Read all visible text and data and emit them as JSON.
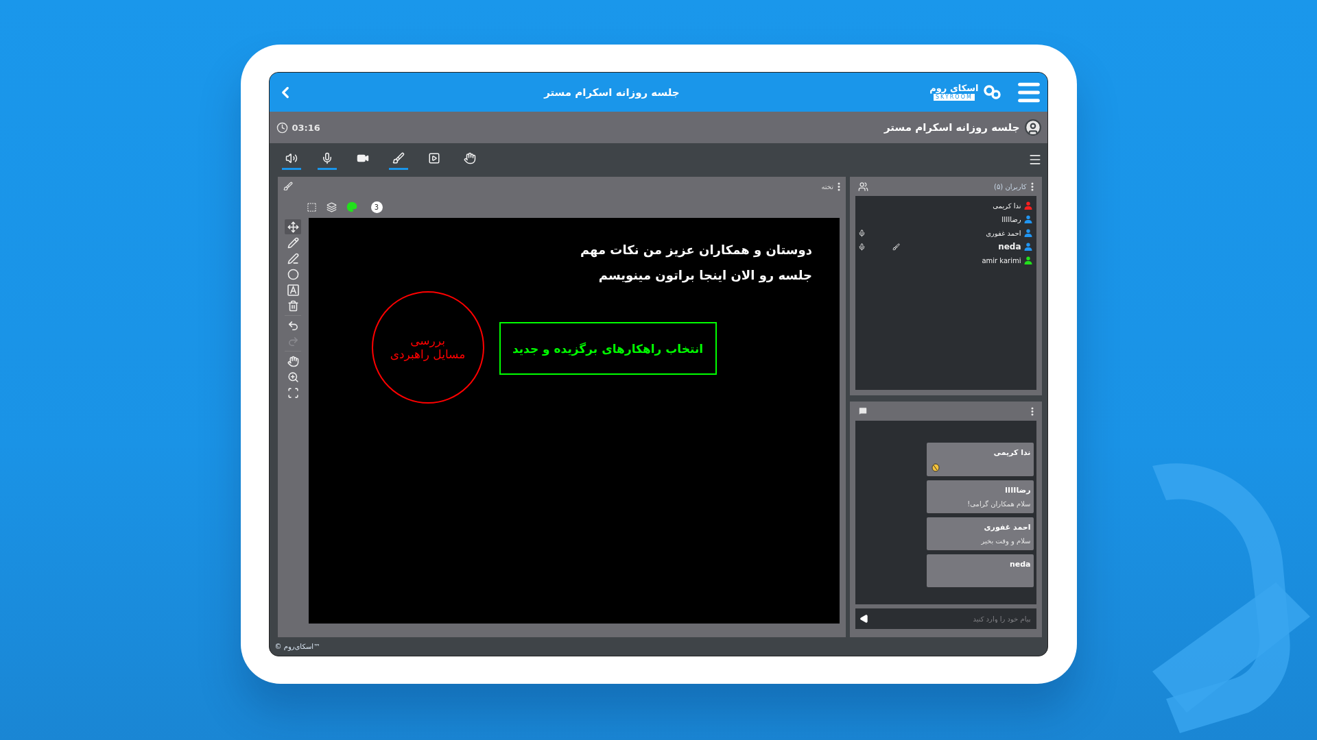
{
  "header": {
    "title": "جلسه روزانه اسکرام مستر",
    "logo_text": "اسکای روم",
    "logo_subtext": "SKYROOM"
  },
  "session_bar": {
    "title": "جلسه روزانه اسکرام مستر",
    "timer": "03:16"
  },
  "toolbar": {
    "items": [
      {
        "kind": "speaker",
        "active": true
      },
      {
        "kind": "mic",
        "active": true
      },
      {
        "kind": "camera",
        "active": false
      },
      {
        "kind": "brush",
        "active": true
      },
      {
        "kind": "screen",
        "active": false
      },
      {
        "kind": "hand",
        "active": false
      }
    ]
  },
  "whiteboard": {
    "title": "تخته",
    "page": "3",
    "top_tools": [
      {
        "kind": "select"
      },
      {
        "kind": "layers"
      },
      {
        "kind": "palette",
        "color": "#22e01c"
      }
    ],
    "tools": [
      {
        "kind": "move",
        "selected": true,
        "disabled": false
      },
      {
        "kind": "pencil",
        "selected": false,
        "disabled": false
      },
      {
        "kind": "pen",
        "selected": false,
        "disabled": false
      },
      {
        "kind": "circle",
        "selected": false,
        "disabled": false
      },
      {
        "kind": "text",
        "selected": false,
        "disabled": false
      },
      {
        "kind": "trash",
        "selected": false,
        "disabled": false
      },
      {
        "kind": "undo",
        "selected": false,
        "disabled": false
      },
      {
        "kind": "redo",
        "selected": false,
        "disabled": true
      },
      {
        "kind": "hand",
        "selected": false,
        "disabled": false
      },
      {
        "kind": "zoom",
        "selected": false,
        "disabled": false
      },
      {
        "kind": "fit",
        "selected": false,
        "disabled": false
      }
    ],
    "shapes": [
      {
        "kind": "text",
        "color": "#ffffff",
        "lines": [
          "دوستان و همکاران عزیز من نکات مهم",
          "جلسه رو الان اینجا براتون مینویسم"
        ]
      },
      {
        "kind": "box",
        "color": "#00ff00",
        "lines": [
          "انتخاب راهکارهای برگزیده و جدید"
        ]
      },
      {
        "kind": "circle",
        "color": "#ff0000",
        "lines": [
          "بررسی",
          "مسایل راهبردی"
        ]
      }
    ]
  },
  "users": {
    "title": "کاربران",
    "count": "(۵)",
    "items": [
      {
        "name": "ندا کریمی",
        "color": "#ff1f1f",
        "mic": false,
        "drawing": false,
        "current": false
      },
      {
        "name": "رضاIIII",
        "color": "#2196f3",
        "mic": false,
        "drawing": false,
        "current": false
      },
      {
        "name": "احمد غفوری",
        "color": "#2196f3",
        "mic": true,
        "drawing": false,
        "current": false
      },
      {
        "name": "neda",
        "color": "#2196f3",
        "mic": true,
        "drawing": true,
        "current": true
      },
      {
        "name": "amir karimi",
        "color": "#22e01c",
        "mic": false,
        "drawing": false,
        "current": false
      }
    ]
  },
  "chat": {
    "placeholder": "پیام خود را وارد کنید",
    "messages": [
      {
        "kind": "emoji",
        "sender": "ندا کریمی"
      },
      {
        "kind": "text",
        "sender": "رضاIIII",
        "text": "سلام همکاران گرامی!"
      },
      {
        "kind": "text",
        "sender": "احمد غفوری",
        "text": "سلام و وقت بخیر"
      },
      {
        "kind": "text",
        "sender": "neda"
      }
    ]
  },
  "footer": {
    "copyright": "© اسکای‌روم™"
  }
}
